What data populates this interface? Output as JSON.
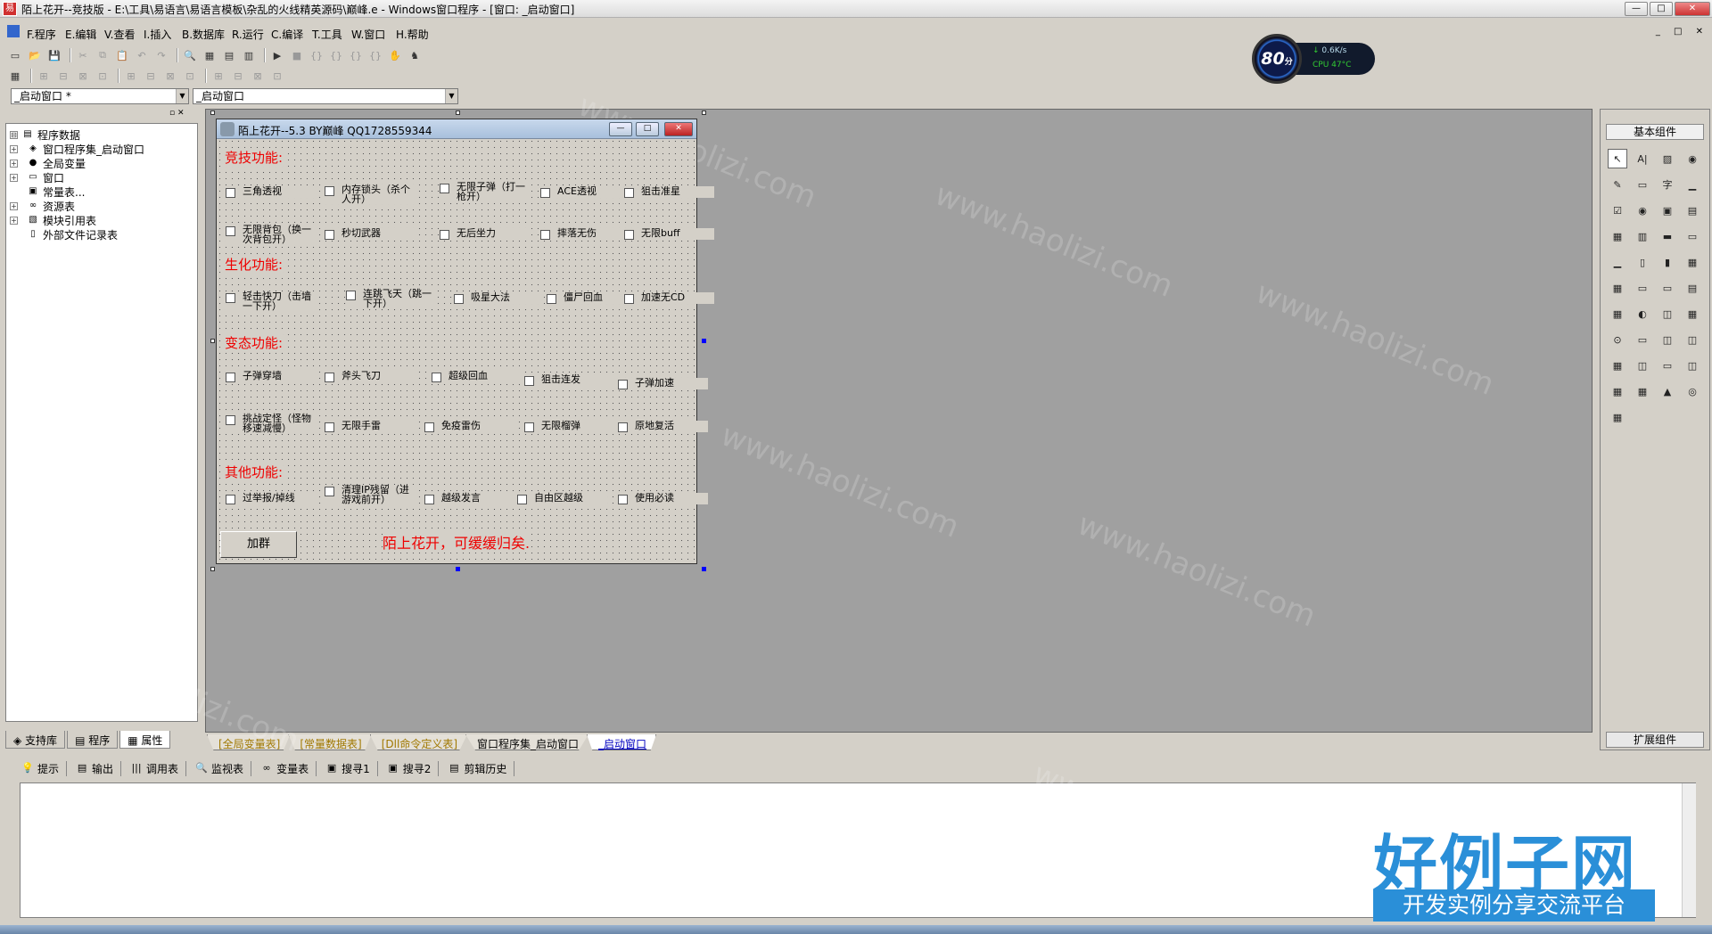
{
  "title_bar": {
    "app_icon_glyph": "易",
    "title": "陌上花开--竞技版 - E:\\工具\\易语言\\易语言模板\\杂乱的火线精英源码\\巅峰.e - Windows窗口程序 - [窗口: _启动窗口]",
    "btn_min": "—",
    "btn_max": "□",
    "btn_close": "✕"
  },
  "menu": {
    "items": [
      "F.程序",
      "E.编辑",
      "V.查看",
      "I.插入",
      "B.数据库",
      "R.运行",
      "C.编译",
      "T.工具",
      "W.窗口",
      "H.帮助"
    ],
    "mdi_buttons": "_ □ ✕"
  },
  "toolbar1": {
    "icons": [
      "new-file-icon",
      "open-folder-icon",
      "save-icon",
      "cut-icon",
      "copy-icon",
      "paste-icon",
      "undo-icon",
      "redo-icon",
      "find-icon",
      "layout1-icon",
      "layout2-icon",
      "layout3-icon",
      "run-icon",
      "stop-icon",
      "step-in-icon",
      "step-over-icon",
      "step-out-icon",
      "run-to-icon",
      "pause-hand-icon",
      "component-icon"
    ],
    "glyphs": [
      "▭",
      "📂",
      "💾",
      "✂",
      "⧉",
      "📋",
      "↶",
      "↷",
      "🔍",
      "▦",
      "▤",
      "▥",
      "▶",
      "■",
      "{}",
      "{}",
      "{}",
      "{}",
      "✋",
      "♞"
    ]
  },
  "toolbar2": {
    "glyphs": [
      "▦",
      "⊞",
      "⊟",
      "⊠",
      "⊡",
      "⊞",
      "⊟",
      "⊠",
      "⊡",
      "⊞",
      "⊟",
      "⊠",
      "⊡"
    ]
  },
  "combos": {
    "left_value": "_启动窗口 *",
    "right_value": "_启动窗口",
    "arrow": "▼"
  },
  "cpu_widget": {
    "score": "80",
    "score_unit": "分",
    "net_speed": "0.6K/s",
    "cpu": "CPU 47°C",
    "net_arrow": "↓"
  },
  "left_panel": {
    "header_buttons": "▫ ✕",
    "tree": [
      {
        "label": "程序数据",
        "expander": "⊟",
        "icon": "▤",
        "indent": 0
      },
      {
        "label": "窗口程序集_启动窗口",
        "expander": "+",
        "icon": "◈",
        "indent": 1
      },
      {
        "label": "全局变量",
        "expander": "+",
        "icon": "●",
        "indent": 1
      },
      {
        "label": "窗口",
        "expander": "+",
        "icon": "▭",
        "indent": 1
      },
      {
        "label": "常量表...",
        "expander": "",
        "icon": "▣",
        "indent": 1
      },
      {
        "label": "资源表",
        "expander": "+",
        "icon": "∞",
        "indent": 1
      },
      {
        "label": "模块引用表",
        "expander": "+",
        "icon": "▧",
        "indent": 1
      },
      {
        "label": "外部文件记录表",
        "expander": "",
        "icon": "▯",
        "indent": 1
      }
    ],
    "tabs": [
      "支持库",
      "程序",
      "属性"
    ]
  },
  "form": {
    "title": "陌上花开--5.3  BY巅峰 QQ1728559344",
    "btn_min": "—",
    "btn_max": "□",
    "btn_close": "✕",
    "sections": {
      "jingji": "竞技功能:",
      "shenghua": "生化功能:",
      "biantai": "变态功能:",
      "qita": "其他功能:"
    },
    "checkboxes": {
      "c1": "三角透视",
      "c2": "内存锁头（杀个人开）",
      "c3": "无限子弹（打一枪开）",
      "c4": "ACE透视",
      "c5": "狙击准星",
      "c6": "无限背包（换一次背包开）",
      "c7": "秒切武器",
      "c8": "无后坐力",
      "c9": "摔落无伤",
      "c10": "无限buff",
      "c11": "轻击快刀（击墙一下开）",
      "c12": "连跳飞天（跳一下开）",
      "c13": "吸星大法",
      "c14": "僵尸回血",
      "c15": "加速无CD",
      "c16": "子弹穿墙",
      "c17": "斧头飞刀",
      "c18": "超级回血",
      "c19": "狙击连发",
      "c20": "子弹加速",
      "c21": "挑战定怪（怪物移速减慢）",
      "c22": "无限手雷",
      "c23": "免疫雷伤",
      "c24": "无限榴弹",
      "c25": "原地复活",
      "c26": "过举报/掉线",
      "c27": "清理IP残留（进游戏前开）",
      "c28": "越级发言",
      "c29": "自由区越级",
      "c30": "使用必读"
    },
    "add_group_button": "加群",
    "slogan": "陌上花开，可缓缓归矣."
  },
  "code_tabs": [
    "[全局变量表]",
    "[常量数据表]",
    "[Dll命令定义表]",
    "窗口程序集_启动窗口",
    "_启动窗口"
  ],
  "right_panel": {
    "header_buttons": "▫ ▫ ✕",
    "basic": "基本组件",
    "extended": "扩展组件",
    "component_glyphs": [
      "↖",
      "A|",
      "▨",
      "◉",
      "✎",
      "▭",
      "字",
      "▁",
      "☑",
      "◉",
      "▣",
      "▤",
      "▦",
      "▥",
      "▬",
      "▭",
      "▁",
      "▯",
      "▮",
      "▦",
      "▦",
      "▭",
      "▭",
      "▤",
      "▦",
      "◐",
      "◫",
      "▦",
      "⊙",
      "▭",
      "◫",
      "◫",
      "▦",
      "◫",
      "▭",
      "◫",
      "▦",
      "▦",
      "▲",
      "◎",
      "▦"
    ]
  },
  "output_tabs": [
    {
      "icon": "💡",
      "label": "提示"
    },
    {
      "icon": "▤",
      "label": "输出"
    },
    {
      "icon": "|||",
      "label": "调用表"
    },
    {
      "icon": "🔍",
      "label": "监视表"
    },
    {
      "icon": "∞",
      "label": "变量表"
    },
    {
      "icon": "▣",
      "label": "搜寻1"
    },
    {
      "icon": "▣",
      "label": "搜寻2"
    },
    {
      "icon": "▤",
      "label": "剪辑历史"
    }
  ],
  "watermark": {
    "logo": "好例子网",
    "tagline": "开发实例分享交流平台",
    "site": "www.haolizi.com"
  }
}
